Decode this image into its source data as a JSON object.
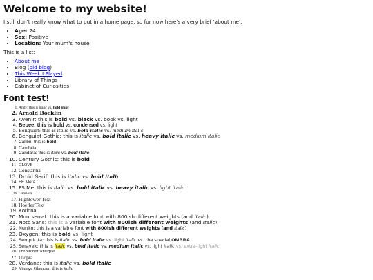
{
  "page": {
    "title": "Welcome to my website!",
    "intro": "I still don't really know what to put in a home page, so for now here's a very brief 'about me':",
    "about": [
      {
        "label": "Age:",
        "value": " 24"
      },
      {
        "label": "Sex:",
        "value": " Positive"
      },
      {
        "label": "Location:",
        "value": " Your mum's house"
      }
    ],
    "list_intro": "This is a list:",
    "links": {
      "about": "About me",
      "blog": "Blog",
      "blog_paren_open": " (",
      "old_blog": "old blog",
      "blog_paren_close": ")",
      "this_week": "This Week I Played",
      "library": "Library of Things",
      "cabinet": "Cabinet of Curiosities"
    },
    "font_test_heading": "Font test!",
    "fonts": {
      "f1": {
        "a": "Andy: this is ",
        "b": "italic",
        "c": " vs. ",
        "d": "bold ",
        "e": "italic"
      },
      "f2": {
        "a": "Arnold Böcklin"
      },
      "f3": {
        "a": "Avenir: this is ",
        "b": "bold",
        "c": " vs. ",
        "d": "black",
        "e": " vs. book vs. light"
      },
      "f4": {
        "a": "Bebee: this is bold",
        "b": " vs. ",
        "c": "condensed",
        "d": " vs. light"
      },
      "f5": {
        "a": "Benguiat: this is ",
        "b": "italic",
        "c": " vs. ",
        "d": "bold italic",
        "e": " vs. ",
        "f": "medium italic"
      },
      "f6": {
        "a": "Benguiat Gothic: this is ",
        "b": "italic",
        "c": " vs. ",
        "d": "bold italic",
        "e": " vs. ",
        "f": "heavy italic",
        "g": " vs. ",
        "h": "medium italic"
      },
      "f7": {
        "a": "Calibri: this is ",
        "b": "bold"
      },
      "f8": {
        "a": "Cambria"
      },
      "f9": {
        "a": "Candara: this is ",
        "b": "italic",
        "c": " vs. ",
        "d": "bold italic"
      },
      "f10": {
        "a": "Century Gothic: this is ",
        "b": "bold"
      },
      "f11": {
        "a": "CLOVE"
      },
      "f12": {
        "a": "Constantia"
      },
      "f13": {
        "a": "Droid Serif: this is ",
        "b": "italic",
        "c": " vs. ",
        "d": "bold italic"
      },
      "f14": {
        "a": "FF Meta"
      },
      "f15": {
        "a": "FS Me: this is ",
        "b": "italic",
        "c": " vs. ",
        "d": "bold italic",
        "e": " vs. ",
        "f": "heavy italic",
        "g": " vs. ",
        "h": "light italic"
      },
      "f16": {
        "a": "Gabriola"
      },
      "f17": {
        "a": "Hightower Text"
      },
      "f18": {
        "a": "Hoefler Text"
      },
      "f19": {
        "a": "Korinna"
      },
      "f20": {
        "a": "Montserrat: this is a variable font with 800ish different weights (and ",
        "b": "italic",
        "c": ")"
      },
      "f21": {
        "a": "Noto Sans: ",
        "b": "this is a",
        "c": " variable font ",
        "d": "with 800ish different weights",
        "e": " (and ",
        "f": "italic",
        "g": ")"
      },
      "f22": {
        "a": "Nunito: this is a variable font ",
        "b": "with 800ish different weights (and ",
        "c": "italic",
        "d": ")"
      },
      "f23": {
        "a": "Oxygen: this is ",
        "b": "bold",
        "c": " vs. light"
      },
      "f24": {
        "a": "Semplicita: this is ",
        "b": "italic",
        "c": " vs. ",
        "d": "bold italic",
        "e": " vs. light ",
        "f": "italic",
        "g": " vs. the special ",
        "h": "OMBRA"
      },
      "f25": {
        "a": "Seravek: this is ",
        "b": "italic",
        "c": " vs. ",
        "d": "bold italic",
        "e": " vs. ",
        "f": "medium italic",
        "g": " vs. light ",
        "h": "italic",
        "i": " vs. extra-light ",
        "j": "italic"
      },
      "f26": {
        "a": "Trebuchet Antique"
      },
      "f27": {
        "a": "Utopia"
      },
      "f28": {
        "a": "Verdana: this is ",
        "b": "italic",
        "c": " vs. ",
        "d": "bold italic"
      },
      "f29": {
        "a": "Vintage Glamour: this is ",
        "b": "italic"
      }
    }
  }
}
